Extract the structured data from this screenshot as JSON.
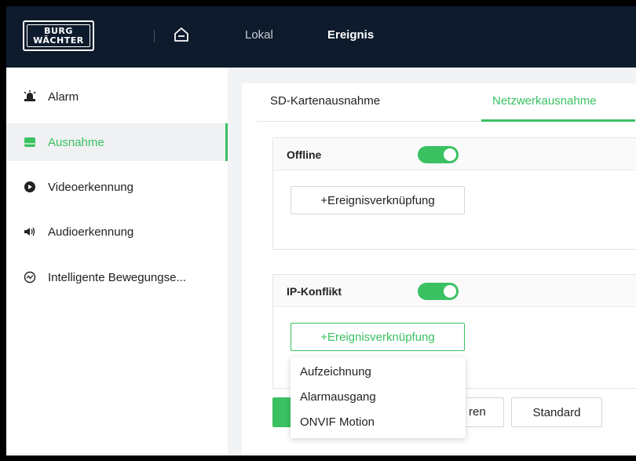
{
  "brand": {
    "line1": "BURG",
    "line2": "WÄCHTER"
  },
  "topnav": {
    "home_icon": "home-icon",
    "items": [
      "Lokal",
      "Ereignis"
    ],
    "active": "Ereignis"
  },
  "sidebar": {
    "items": [
      {
        "label": "Alarm",
        "icon": "alarm-icon"
      },
      {
        "label": "Ausnahme",
        "icon": "exception-icon",
        "active": true
      },
      {
        "label": "Videoerkennung",
        "icon": "video-icon"
      },
      {
        "label": "Audioerkennung",
        "icon": "audio-icon"
      },
      {
        "label": "Intelligente Bewegungse...",
        "icon": "motion-icon"
      }
    ]
  },
  "tabs": [
    {
      "label": "SD-Kartenausnahme"
    },
    {
      "label": "Netzwerkausnahme",
      "active": true
    }
  ],
  "sections": [
    {
      "title": "Offline",
      "enabled": true,
      "button": "+Ereignisverknüpfung"
    },
    {
      "title": "IP-Konflikt",
      "enabled": true,
      "button": "+Ereignisverknüpfung"
    }
  ],
  "dropdown": {
    "items": [
      "Aufzeichnung",
      "Alarmausgang",
      "ONVIF Motion"
    ]
  },
  "actions": {
    "back_fragment": "ren",
    "standard": "Standard"
  },
  "colors": {
    "accent": "#3ac162",
    "topbar": "#0d1b2c"
  }
}
